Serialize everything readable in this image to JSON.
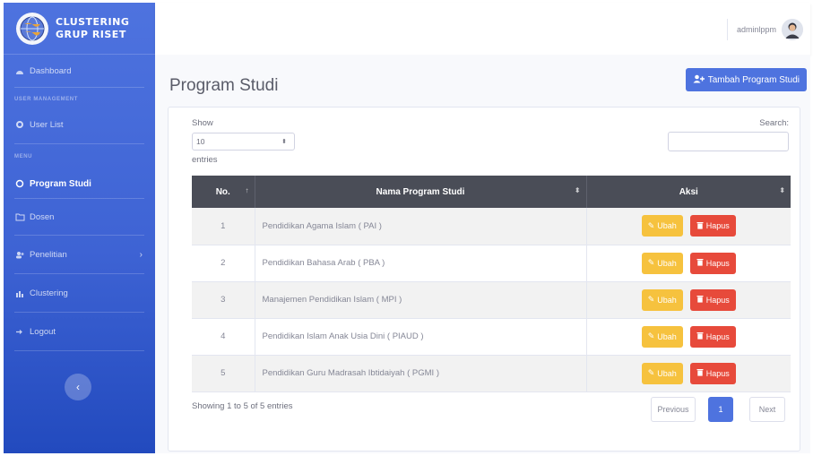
{
  "brand": {
    "line1": "CLUSTERING",
    "line2": "GRUP RISET",
    "logo_icon": "globe-logo-icon"
  },
  "sidebar": {
    "dashboard": "Dashboard",
    "section_user": "USER MANAGEMENT",
    "user_list": "User List",
    "section_menu": "MENU",
    "program_studi": "Program Studi",
    "dosen": "Dosen",
    "penelitian": "Penelitian",
    "clustering": "Clustering",
    "logout": "Logout"
  },
  "topbar": {
    "username": "adminlppm"
  },
  "page": {
    "title": "Program Studi",
    "add_button": "Tambah Program Studi"
  },
  "table_controls": {
    "show_label": "Show",
    "entries_value": "10",
    "entries_label": "entries",
    "search_label": "Search:"
  },
  "table": {
    "headers": {
      "no": "No.",
      "name": "Nama Program Studi",
      "action": "Aksi"
    },
    "rows": [
      {
        "no": "1",
        "name": "Pendidikan Agama Islam ( PAI )"
      },
      {
        "no": "2",
        "name": "Pendidikan Bahasa Arab ( PBA )"
      },
      {
        "no": "3",
        "name": "Manajemen Pendidikan Islam ( MPI )"
      },
      {
        "no": "4",
        "name": "Pendidikan Islam Anak Usia Dini ( PIAUD )"
      },
      {
        "no": "5",
        "name": "Pendidikan Guru Madrasah Ibtidaiyah ( PGMI )"
      }
    ],
    "edit_label": "Ubah",
    "delete_label": "Hapus"
  },
  "footer": {
    "info": "Showing 1 to 5 of 5 entries",
    "previous": "Previous",
    "current_page": "1",
    "next": "Next"
  },
  "colors": {
    "primary": "#4e73df",
    "warning": "#f6c23e",
    "danger": "#e74a3b",
    "table_header": "#4a4d57"
  }
}
